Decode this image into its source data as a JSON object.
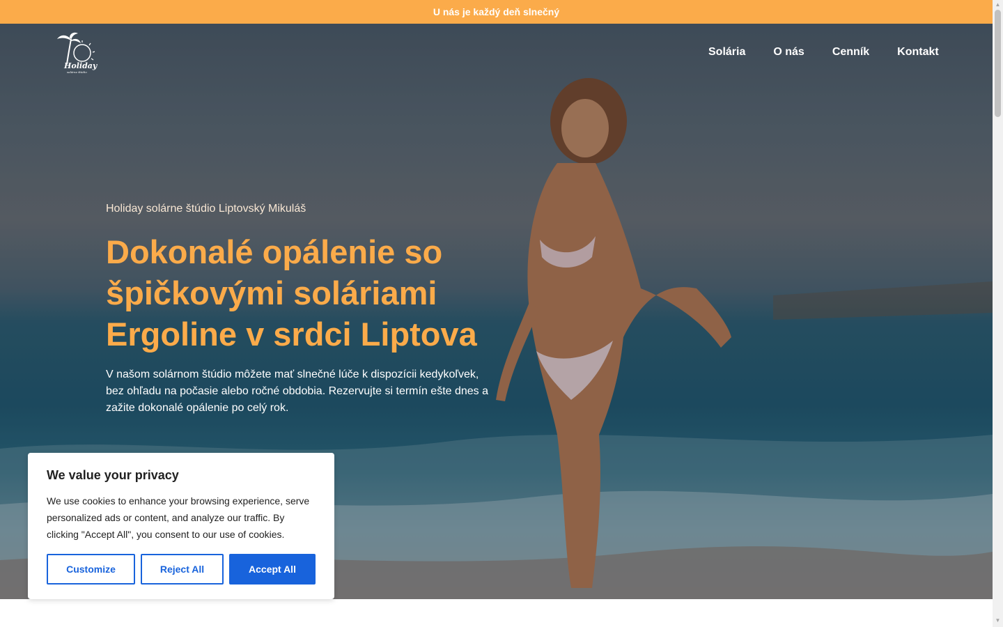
{
  "topbar": {
    "text": "U nás je každý deň slnečný"
  },
  "header": {
    "logo_icon": "holiday-palm-sun-logo",
    "logo_text": "Holiday",
    "logo_subtext": "solárne štúdio",
    "nav": [
      "Solária",
      "O nás",
      "Cenník",
      "Kontakt"
    ]
  },
  "hero": {
    "subtitle": "Holiday solárne štúdio Liptovský Mikuláš",
    "title": "Dokonalé opálenie so špičkovými soláriami Ergoline v srdci Liptova",
    "text": "V našom solárnom štúdio môžete mať slnečné lúče k dispozícii kedykoľvek, bez ohľadu na počasie alebo ročné obdobia. Rezervujte si termín ešte dnes a zažite dokonalé opálenie po celý rok."
  },
  "cookie": {
    "title": "We value your privacy",
    "text": "We use cookies to enhance your browsing experience, serve personalized ads or content, and analyze our traffic. By clicking \"Accept All\", you consent to our use of cookies.",
    "customize": "Customize",
    "reject": "Reject All",
    "accept": "Accept All"
  },
  "colors": {
    "accent": "#fbab4a",
    "cookie_button": "#1863dc"
  }
}
